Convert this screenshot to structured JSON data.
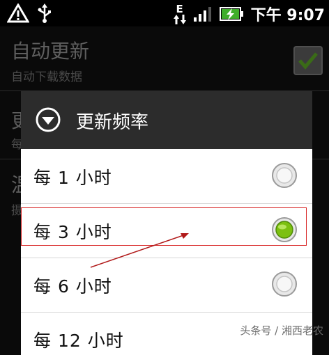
{
  "status_bar": {
    "time": "下午 9:07",
    "network_indicator": "E",
    "icons": [
      "warning-icon",
      "usb-icon",
      "data-transfer-icon",
      "signal-icon",
      "battery-charging-icon"
    ]
  },
  "background_settings": {
    "auto_update_title": "自动更新",
    "auto_update_subtitle": "自动下载数据",
    "auto_update_checked": true,
    "partial_title_2": "更",
    "partial_subtitle_2": "每",
    "partial_title_3": "温",
    "partial_subtitle_3": "摄"
  },
  "dialog": {
    "title": "更新频率",
    "options": [
      {
        "label": "每 1 小时",
        "selected": false
      },
      {
        "label": "每 3 小时",
        "selected": true
      },
      {
        "label": "每 6 小时",
        "selected": false
      },
      {
        "label": "每 12 小时",
        "selected": false
      }
    ]
  },
  "colors": {
    "highlight_box": "#d72020",
    "radio_selected": "#7cc010"
  },
  "watermark": "头条号 / 湘西老农"
}
